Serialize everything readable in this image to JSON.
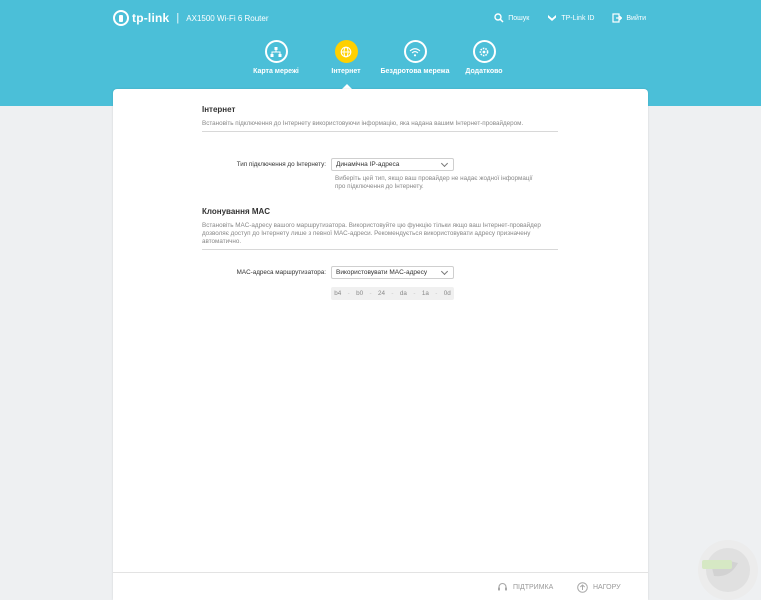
{
  "header": {
    "brand": "tp-link",
    "separator": "|",
    "model": "AX1500 Wi-Fi 6 Router",
    "links": [
      {
        "label": "Пошук",
        "icon": "search-icon"
      },
      {
        "label": "TP-Link ID",
        "icon": "tplink-id-icon"
      },
      {
        "label": "Вийти",
        "icon": "logout-icon"
      }
    ]
  },
  "nav": {
    "items": [
      {
        "label": "Карта мережі",
        "icon": "network-map-icon",
        "active": false
      },
      {
        "label": "Інтернет",
        "icon": "globe-icon",
        "active": true
      },
      {
        "label": "Бездротова мережа",
        "icon": "wifi-icon",
        "active": false
      },
      {
        "label": "Додатково",
        "icon": "gear-icon",
        "active": false
      }
    ]
  },
  "internet": {
    "title": "Інтернет",
    "description": "Встановіть підключення до Інтернету використовуючи інформацію, яка надана вашим Інтернет-провайдером.",
    "connection_label": "Тип підключення до Інтернету:",
    "connection_value": "Динамічна IP-адреса",
    "connection_hint": "Виберіть цей тип, якщо ваш провайдер не надає жодної інформації про підключення до Інтернету."
  },
  "mac_clone": {
    "title": "Клонування MAC",
    "description": "Встановіть MAC-адресу вашого маршрутизатора. Використовуйте цю функцію тільки якщо ваш Інтернет-провайдер дозволяє доступ до Інтернету лише з певної MAC-адреси. Рекомендується використовувати адресу призначену автоматично.",
    "router_mac_label": "MAC-адреса маршрутизатора:",
    "router_mac_value": "Використовувати MAC-адресу",
    "mac_octets": [
      "b4",
      "b0",
      "24",
      "da",
      "1a",
      "0d"
    ],
    "mac_separator": "-"
  },
  "footer": {
    "support": "ПІДТРИМКА",
    "back_to_top": "НАГОРУ"
  },
  "colors": {
    "header_bg": "#4bbfd8",
    "active_nav": "#ffd000",
    "page_bg": "#eef0f2"
  }
}
